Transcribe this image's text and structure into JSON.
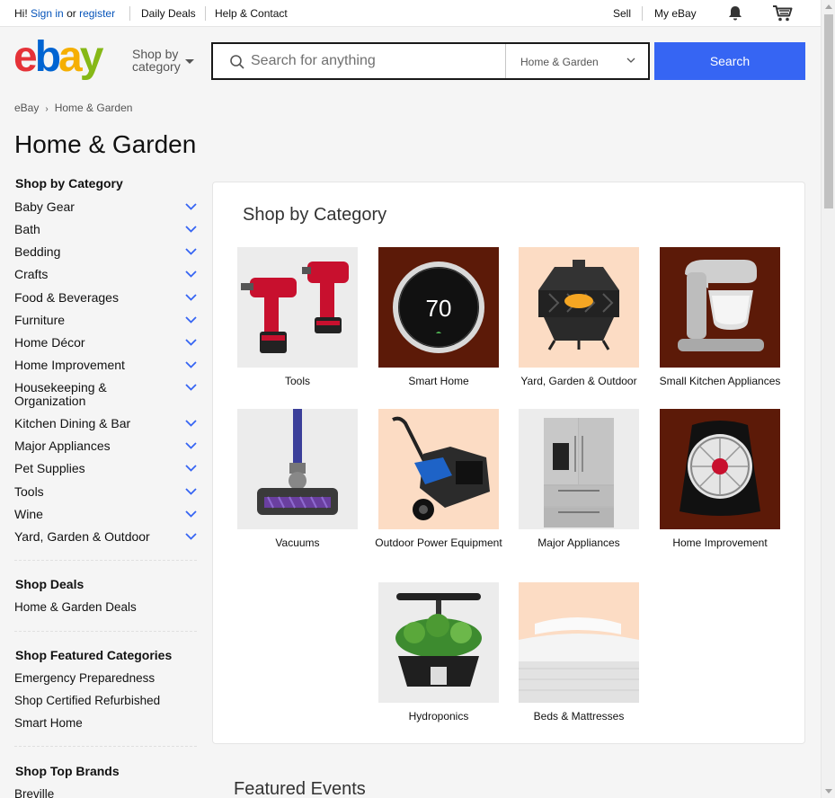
{
  "topbar": {
    "greeting_prefix": "Hi!",
    "sign_in": "Sign in",
    "or": "or",
    "register": "register",
    "daily_deals": "Daily Deals",
    "help_contact": "Help & Contact",
    "sell": "Sell",
    "my_ebay": "My eBay"
  },
  "header": {
    "shop_by_line1": "Shop by",
    "shop_by_line2": "category",
    "search_placeholder": "Search for anything",
    "search_category": "Home & Garden",
    "search_button": "Search",
    "logo_colors": [
      "#e53238",
      "#0064d2",
      "#f5af02",
      "#86b817"
    ]
  },
  "breadcrumb": {
    "root": "eBay",
    "current": "Home & Garden"
  },
  "page_title": "Home & Garden",
  "sidebar": {
    "shop_by_category": "Shop by Category",
    "categories": [
      "Baby Gear",
      "Bath",
      "Bedding",
      "Crafts",
      "Food & Beverages",
      "Furniture",
      "Home Décor",
      "Home Improvement",
      "Housekeeping & Organization",
      "Kitchen Dining & Bar",
      "Major Appliances",
      "Pet Supplies",
      "Tools",
      "Wine",
      "Yard, Garden & Outdoor"
    ],
    "shop_deals": "Shop Deals",
    "deals_links": [
      "Home & Garden Deals"
    ],
    "shop_featured": "Shop Featured Categories",
    "featured_links": [
      "Emergency Preparedness",
      "Shop Certified Refurbished",
      "Smart Home"
    ],
    "shop_top_brands": "Shop Top Brands",
    "brand_links": [
      "Breville"
    ]
  },
  "main": {
    "card_title": "Shop by Category",
    "tiles": [
      {
        "label": "Tools"
      },
      {
        "label": "Smart Home"
      },
      {
        "label": "Yard, Garden & Outdoor"
      },
      {
        "label": "Small Kitchen Appliances"
      },
      {
        "label": "Vacuums"
      },
      {
        "label": "Outdoor Power Equipment"
      },
      {
        "label": "Major Appliances"
      },
      {
        "label": "Home Improvement"
      },
      {
        "label": "Hydroponics"
      },
      {
        "label": "Beds & Mattresses"
      }
    ],
    "thermostat_reading": "70",
    "featured_events": "Featured Events"
  },
  "colors": {
    "accent": "#3665f3",
    "link": "#0654ba"
  }
}
